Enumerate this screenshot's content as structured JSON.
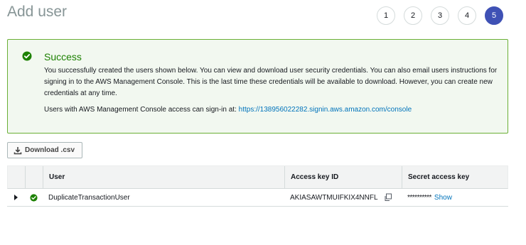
{
  "page": {
    "title": "Add user"
  },
  "steps": [
    "1",
    "2",
    "3",
    "4",
    "5"
  ],
  "alert": {
    "title": "Success",
    "body": "You successfully created the users shown below. You can view and download user security credentials. You can also email users instructions for signing in to the AWS Management Console. This is the last time these credentials will be available to download. However, you can create new credentials at any time.",
    "signin_prefix": "Users with AWS Management Console access can sign-in at: ",
    "signin_url": "https://138956022282.signin.aws.amazon.com/console"
  },
  "toolbar": {
    "download_label": "Download .csv"
  },
  "table": {
    "headers": {
      "user": "User",
      "access_key": "Access key ID",
      "secret_key": "Secret access key"
    },
    "rows": [
      {
        "user": "DuplicateTransactionUser",
        "access_key": "AKIASAWTMUIFKIX4NNFL",
        "secret_masked": "**********",
        "show_label": "Show"
      }
    ]
  },
  "colors": {
    "success": "#1d8102",
    "accent": "#3f51b5",
    "link": "#0073bb"
  }
}
